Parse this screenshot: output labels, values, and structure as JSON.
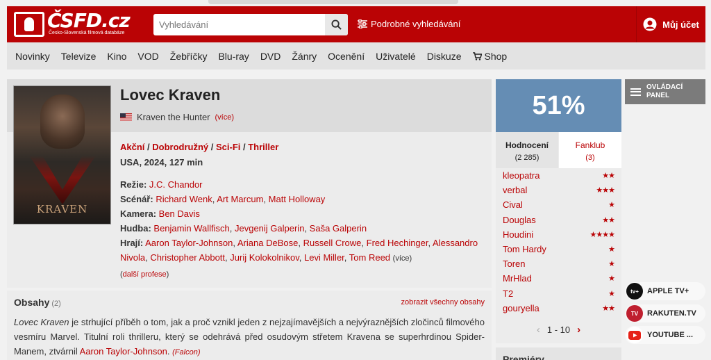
{
  "header": {
    "logo_text": "ČSFD.cz",
    "logo_sub": "Česko-Slovenská filmová databáze",
    "search_placeholder": "Vyhledávání",
    "advanced_search": "Podrobné vyhledávání",
    "account": "Můj účet",
    "brand_color": "#ba0305"
  },
  "nav": {
    "items": [
      "Novinky",
      "Televize",
      "Kino",
      "VOD",
      "Žebříčky",
      "Blu-ray",
      "DVD",
      "Žánry",
      "Ocenění",
      "Uživatelé",
      "Diskuze",
      "Shop"
    ]
  },
  "film": {
    "title": "Lovec Kraven",
    "original_title": "Kraven the Hunter",
    "more": "(více)",
    "poster_title": "KRAVEN",
    "genres": [
      "Akční",
      "Dobrodružný",
      "Sci-Fi",
      "Thriller"
    ],
    "origin": "USA, 2024, 127 min",
    "crew": {
      "director_label": "Režie:",
      "director": "J.C. Chandor",
      "writers_label": "Scénář:",
      "writers": [
        "Richard Wenk",
        "Art Marcum",
        "Matt Holloway"
      ],
      "camera_label": "Kamera:",
      "camera": "Ben Davis",
      "music_label": "Hudba:",
      "music": [
        "Benjamin Wallfisch",
        "Jevgenij Galperin",
        "Saša Galperin"
      ],
      "cast_label": "Hrají:",
      "cast": [
        "Aaron Taylor-Johnson",
        "Ariana DeBose",
        "Russell Crowe",
        "Fred Hechinger",
        "Alessandro Nivola",
        "Christopher Abbott",
        "Jurij Kolokolnikov",
        "Levi Miller",
        "Tom Reed"
      ],
      "cast_more": "(více)",
      "other_professions": "další profese"
    }
  },
  "plot": {
    "heading": "Obsahy",
    "count": "(2)",
    "show_all": "zobrazit všechny obsahy",
    "title_italic": "Lovec Kraven",
    "text": " je strhující příběh o tom, jak a proč vznikl jeden z nejzajímavějších a nejvýraznějších zločinců filmového vesmíru Marvel. Titulní roli thrilleru, který se odehrává před osudovým střetem Kravena se superhrdinou Spider-Manem, ztvárnil ",
    "actor": "Aaron Taylor-Johnson",
    "end": ".",
    "author": "(Falcon)"
  },
  "rating": {
    "score": "51%",
    "score_color": "#658db4",
    "tab_ratings": "Hodnocení",
    "tab_ratings_count": "(2 285)",
    "tab_fanclub": "Fanklub",
    "tab_fanclub_count": "(3)",
    "users": [
      {
        "name": "kleopatra",
        "stars": "★★",
        "level": 2
      },
      {
        "name": "verbal",
        "stars": "★★★",
        "level": 3
      },
      {
        "name": "Cival",
        "stars": "★",
        "level": 1
      },
      {
        "name": "Douglas",
        "stars": "★★",
        "level": 2
      },
      {
        "name": "Houdini",
        "stars": "★★★★",
        "level": 4
      },
      {
        "name": "Tom Hardy",
        "stars": "★",
        "level": 1
      },
      {
        "name": "Toren",
        "stars": "★",
        "level": 1
      },
      {
        "name": "MrHlad",
        "stars": "★",
        "level": 1
      },
      {
        "name": "T2",
        "stars": "★",
        "level": 1
      },
      {
        "name": "gouryella",
        "stars": "★★",
        "level": 2
      }
    ],
    "pager": "1 - 10",
    "premieres": "Premiéry"
  },
  "panel": {
    "label_line1": "OVLÁDACÍ",
    "label_line2": "PANEL"
  },
  "streaming": [
    {
      "label": "APPLE TV+",
      "icon": "apple-tv-icon",
      "color": "#111111"
    },
    {
      "label": "RAKUTEN.TV",
      "icon": "rakuten-tv-icon",
      "color": "#bf1f2f"
    },
    {
      "label": "YOUTUBE ...",
      "icon": "youtube-icon",
      "color": "#e62117"
    }
  ]
}
